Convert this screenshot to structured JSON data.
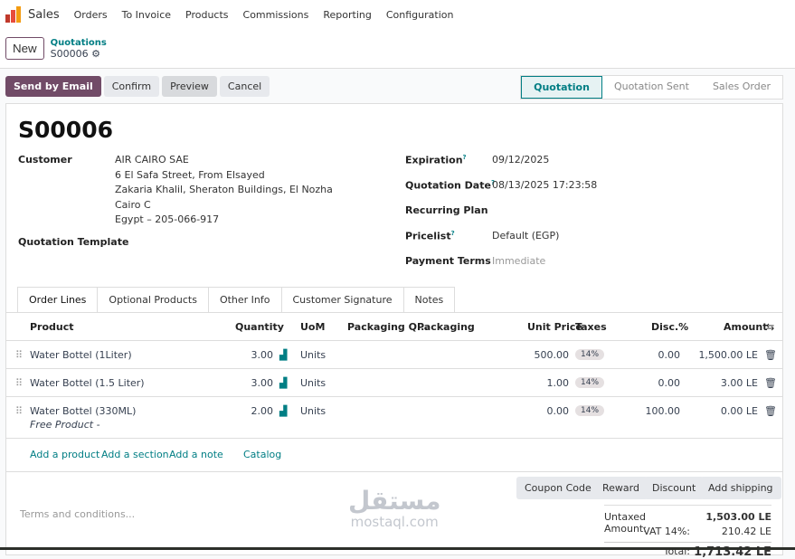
{
  "nav": {
    "app": "Sales",
    "items": [
      "Orders",
      "To Invoice",
      "Products",
      "Commissions",
      "Reporting",
      "Configuration"
    ]
  },
  "cp": {
    "new": "New",
    "breadcrumb": "Quotations",
    "record": "S00006"
  },
  "actions": {
    "send": "Send by Email",
    "confirm": "Confirm",
    "preview": "Preview",
    "cancel": "Cancel"
  },
  "status": [
    "Quotation",
    "Quotation Sent",
    "Sales Order"
  ],
  "form": {
    "name": "S00006",
    "customer_label": "Customer",
    "customer": [
      "AIR CAIRO SAE",
      "6 El Safa Street, From Elsayed",
      "Zakaria Khalil, Sheraton Buildings, El Nozha",
      "Cairo C",
      "Egypt – 205-066-917"
    ],
    "template_label": "Quotation Template",
    "expiration_label": "Expiration",
    "expiration": "09/12/2025",
    "qdate_label": "Quotation Date",
    "qdate": "08/13/2025 17:23:58",
    "recurring_label": "Recurring Plan",
    "pricelist_label": "Pricelist",
    "pricelist": "Default (EGP)",
    "terms_label": "Payment Terms",
    "terms": "Immediate",
    "help": "?"
  },
  "tabs": [
    "Order Lines",
    "Optional Products",
    "Other Info",
    "Customer Signature",
    "Notes"
  ],
  "table": {
    "headers": [
      "Product",
      "Quantity",
      "UoM",
      "Packaging Q...",
      "Packaging",
      "Unit Price",
      "Taxes",
      "Disc.%",
      "Amount"
    ],
    "rows": [
      {
        "product": "Water Bottel (1Liter)",
        "qty": "3.00",
        "uom": "Units",
        "price": "500.00",
        "tax": "14%",
        "disc": "0.00",
        "amount": "1,500.00 LE"
      },
      {
        "product": "Water Bottel (1.5 Liter)",
        "qty": "3.00",
        "uom": "Units",
        "price": "1.00",
        "tax": "14%",
        "disc": "0.00",
        "amount": "3.00 LE"
      },
      {
        "product": "Water Bottel (330ML)",
        "note": "Free Product -",
        "qty": "2.00",
        "uom": "Units",
        "price": "0.00",
        "tax": "14%",
        "disc": "100.00",
        "amount": "0.00 LE"
      }
    ],
    "add": [
      "Add a product",
      "Add a section",
      "Add a note",
      "Catalog"
    ]
  },
  "footer": {
    "buttons": [
      "Coupon Code",
      "Reward",
      "Discount",
      "Add shipping"
    ],
    "terms_placeholder": "Terms and conditions...",
    "untaxed_label": "Untaxed Amount:",
    "untaxed": "1,503.00 LE",
    "vat_label": "VAT 14%:",
    "vat": "210.42 LE",
    "total_label": "Total:",
    "total": "1,713.42 LE"
  },
  "watermark": {
    "ar": "مستقل",
    "en": "mostaql.com"
  }
}
